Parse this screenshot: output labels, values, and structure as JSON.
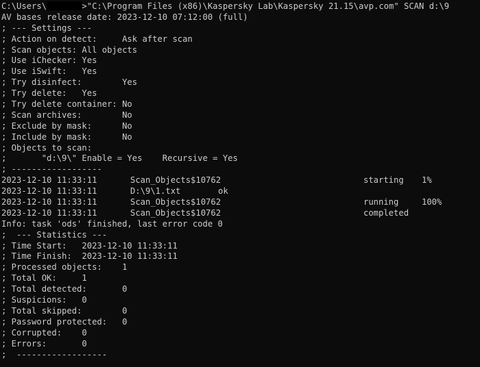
{
  "prompt": {
    "prefix": "C:\\Users\\",
    "suffix": ">\"C:\\Program Files (x86)\\Kaspersky Lab\\Kaspersky 21.15\\avp.com\" SCAN d:\\9"
  },
  "av_bases_line": "AV bases release date: 2023-12-10 07:12:00 (full)",
  "settings_lines": [
    "; --- Settings ---",
    "; Action on detect:     Ask after scan",
    "; Scan objects: All objects",
    "; Use iChecker: Yes",
    "; Use iSwift:   Yes",
    "; Try disinfect:        Yes",
    "; Try delete:   Yes",
    "; Try delete container: No",
    "; Scan archives:        No",
    "; Exclude by mask:      No",
    "; Include by mask:      No",
    "; Objects to scan:",
    ";       \"d:\\9\\\" Enable = Yes    Recursive = Yes",
    "; ------------------"
  ],
  "log_rows": [
    {
      "time": "2023-12-10 11:33:11",
      "object": "Scan_Objects$10762",
      "status": "starting",
      "progress": "1%"
    },
    {
      "time": "2023-12-10 11:33:11",
      "object": "D:\\9\\1.txt",
      "result": "ok"
    },
    {
      "time": "2023-12-10 11:33:11",
      "object": "Scan_Objects$10762",
      "status": "running",
      "progress": "100%"
    },
    {
      "time": "2023-12-10 11:33:11",
      "object": "Scan_Objects$10762",
      "status": "completed",
      "progress": ""
    }
  ],
  "info_line": "Info: task 'ods' finished, last error code 0",
  "statistics_lines": [
    ";  --- Statistics ---",
    "; Time Start:   2023-12-10 11:33:11",
    "; Time Finish:  2023-12-10 11:33:11",
    "; Processed objects:    1",
    "; Total OK:     1",
    "; Total detected:       0",
    "; Suspicions:   0",
    "; Total skipped:        0",
    "; Password protected:   0",
    "; Corrupted:    0",
    "; Errors:       0",
    ";  ------------------"
  ],
  "colors": {
    "background": "#0c0c0c",
    "text": "#cccccc",
    "redaction": "#000000"
  }
}
